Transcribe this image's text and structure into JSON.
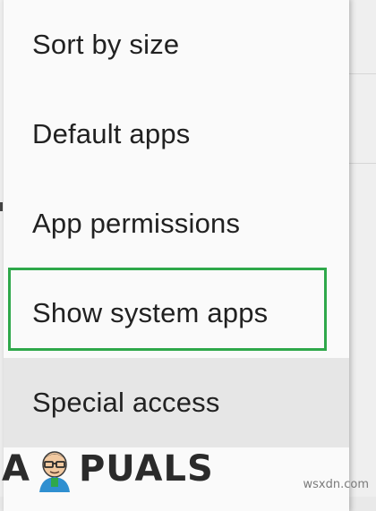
{
  "menu": {
    "items": [
      {
        "label": "Sort by size"
      },
      {
        "label": "Default apps"
      },
      {
        "label": "App permissions"
      },
      {
        "label": "Show system apps"
      },
      {
        "label": "Special access"
      }
    ],
    "highlighted_item": "Show system apps",
    "highlight_color": "#2ea84a",
    "pressed_item": "Special access"
  },
  "watermark": {
    "brand_letter_a": "A",
    "brand_rest": "PUALS",
    "brand_logo_icon": "appuals-mascot-icon",
    "site": "wsxdn.com"
  }
}
